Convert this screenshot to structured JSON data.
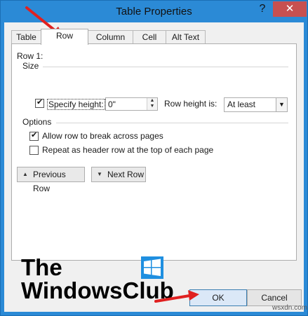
{
  "window": {
    "title": "Table Properties",
    "help_label": "?",
    "close_label": "✕"
  },
  "tabs": [
    {
      "label": "Table",
      "key": "T"
    },
    {
      "label": "Row",
      "key": "R"
    },
    {
      "label": "Column",
      "key": "U"
    },
    {
      "label": "Cell",
      "key": "E"
    },
    {
      "label": "Alt Text",
      "key": "A"
    }
  ],
  "row_panel": {
    "row_label": "Row 1:",
    "size_label": "Size",
    "specify_height_label": "Specify height:",
    "specify_height_checked": true,
    "height_value": "0\"",
    "row_height_is_label": "Row height is:",
    "row_height_is_value": "At least",
    "options_label": "Options",
    "allow_break_label": "Allow row to break across pages",
    "allow_break_checked": true,
    "repeat_header_label": "Repeat as header row at the top of each page",
    "repeat_header_checked": false,
    "previous_row_label": "Previous Row",
    "next_row_label": "Next Row"
  },
  "branding": {
    "line1": "The",
    "line2": "WindowsClub",
    "logo_icon": "windows-logo-icon"
  },
  "footer": {
    "ok_label": "OK",
    "cancel_label": "Cancel"
  },
  "watermark": "wsxdn.com",
  "annotation_color": "#e02020"
}
